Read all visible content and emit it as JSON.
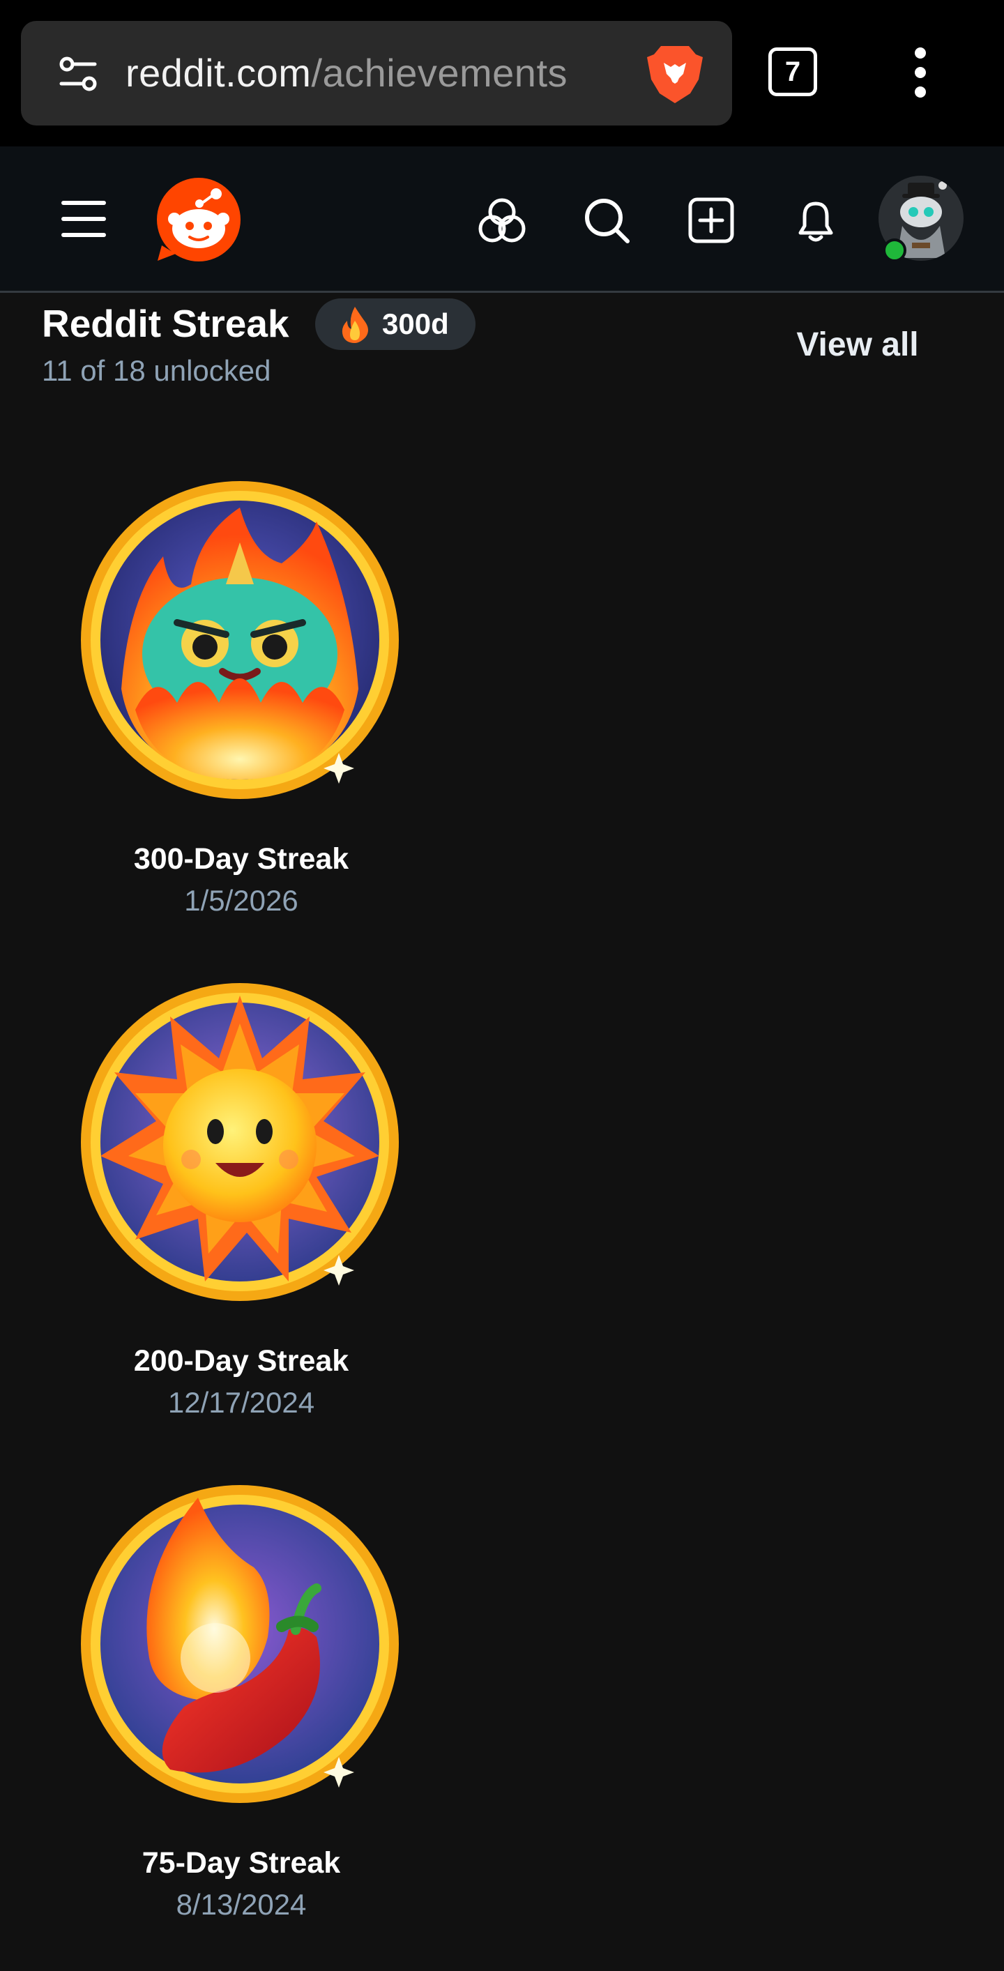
{
  "browser": {
    "url_host": "reddit.com",
    "url_path": "/achievements",
    "tab_count": "7",
    "icons": [
      "site-settings-icon",
      "brave-lion-icon",
      "more-vertical-icon"
    ]
  },
  "header": {
    "icons": [
      "hamburger-menu-icon",
      "reddit-snoo-logo",
      "communities-icon",
      "search-icon",
      "create-post-icon",
      "notifications-bell-icon",
      "user-avatar"
    ],
    "colors": {
      "brand": "#ff4500",
      "online": "#1fb83a"
    }
  },
  "section": {
    "title": "Reddit Streak",
    "streak_badge": "300d",
    "unlocked": "11 of 18 unlocked",
    "view_all": "View all"
  },
  "achievements": [
    {
      "name": "300-Day Streak",
      "date": "1/5/2026",
      "icon": "flaming-monster-badge"
    },
    {
      "name": "200-Day Streak",
      "date": "12/17/2024",
      "icon": "smiling-sun-badge"
    },
    {
      "name": "75-Day Streak",
      "date": "8/13/2024",
      "icon": "chili-pepper-badge"
    }
  ]
}
